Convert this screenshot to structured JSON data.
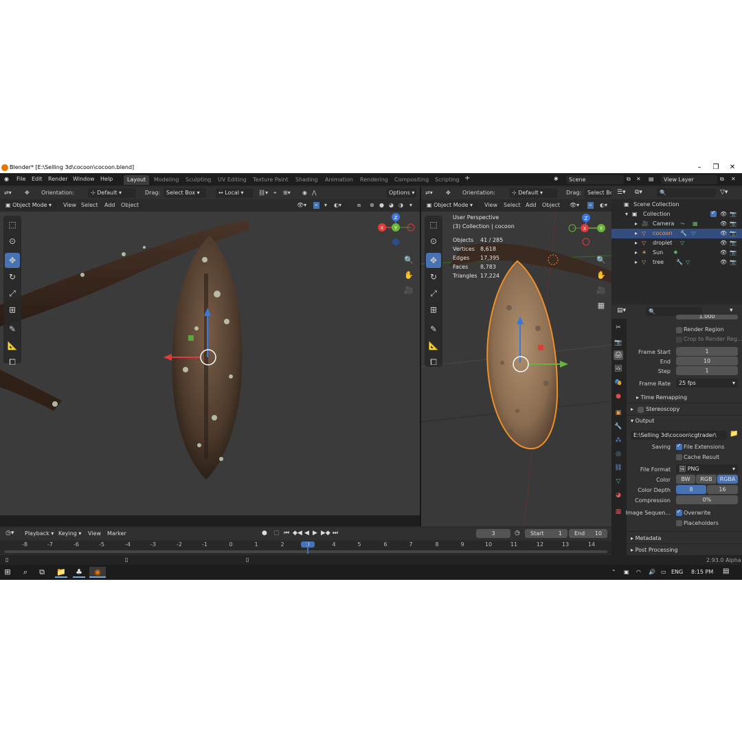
{
  "window": {
    "title": "Blender* [E:\\Selling 3d\\cocoon\\cocoon.blend]",
    "minimize_icon": "minimize-icon",
    "maximize_icon": "maximize-icon",
    "close_icon": "close-icon"
  },
  "menu": [
    "File",
    "Edit",
    "Render",
    "Window",
    "Help"
  ],
  "workspaces": [
    "Layout",
    "Modeling",
    "Sculpting",
    "UV Editing",
    "Texture Paint",
    "Shading",
    "Animation",
    "Rendering",
    "Compositing",
    "Scripting"
  ],
  "add_workspace": "+",
  "scene": {
    "name": "Scene",
    "view_layer": "View Layer"
  },
  "left_header": {
    "orientation_label": "Orientation:",
    "orientation_value": "Default",
    "drag_label": "Drag:",
    "drag_value": "Select Box",
    "pivot_value": "Local",
    "options": "Options"
  },
  "left_viewport_header": {
    "mode": "Object Mode",
    "view": "View",
    "select": "Select",
    "add": "Add",
    "object": "Object"
  },
  "right_header": {
    "orientation_label": "Orientation:",
    "orientation_value": "Default",
    "drag_label": "Drag:",
    "drag_value": "Select Bo"
  },
  "right_viewport_header": {
    "mode": "Object Mode",
    "view": "View",
    "select": "Select",
    "add": "Add",
    "object": "Object"
  },
  "overlay_text": {
    "perspective": "User Perspective",
    "collection": "(3) Collection | cocoon",
    "stats": [
      {
        "label": "Objects",
        "value": "41 / 285"
      },
      {
        "label": "Vertices",
        "value": "8,618"
      },
      {
        "label": "Edges",
        "value": "17,395"
      },
      {
        "label": "Faces",
        "value": "8,783"
      },
      {
        "label": "Triangles",
        "value": "17,224"
      }
    ]
  },
  "gizmo_axes": {
    "x": "X",
    "y": "Y",
    "z": "Z"
  },
  "outliner": {
    "root": "Scene Collection",
    "collection": "Collection",
    "items": [
      {
        "name": "Camera",
        "selected": false
      },
      {
        "name": "cocoon",
        "selected": true
      },
      {
        "name": "droplet",
        "selected": false
      },
      {
        "name": "Sun",
        "selected": false
      },
      {
        "name": "tree",
        "selected": false
      }
    ]
  },
  "properties": {
    "top_value": "1.000",
    "render_region": "Render Region",
    "crop_region": "Crop to Render Reg...",
    "frame_start_label": "Frame Start",
    "frame_start": "1",
    "end_label": "End",
    "end": "10",
    "step_label": "Step",
    "step": "1",
    "frame_rate_label": "Frame Rate",
    "frame_rate": "25 fps",
    "time_remapping": "Time Remapping",
    "stereoscopy": "Stereoscopy",
    "output": "Output",
    "output_path": "E:\\Selling 3d\\cocoon\\cgtrader\\",
    "saving_label": "Saving",
    "file_extensions": "File Extensions",
    "cache_result": "Cache Result",
    "file_format_label": "File Format",
    "file_format": "PNG",
    "color_label": "Color",
    "color_options": [
      "BW",
      "RGB",
      "RGBA"
    ],
    "color_depth_label": "Color Depth",
    "color_depth_options": [
      "8",
      "16"
    ],
    "compression_label": "Compression",
    "compression": "0%",
    "image_sequence_label": "Image Sequen...",
    "overwrite": "Overwrite",
    "placeholders": "Placeholders",
    "metadata": "Metadata",
    "post_processing": "Post Processing"
  },
  "timeline": {
    "playback": "Playback",
    "keying": "Keying",
    "view": "View",
    "marker": "Marker",
    "current_frame": "3",
    "start_label": "Start",
    "start": "1",
    "end_label": "End",
    "end": "10",
    "ruler": [
      "-8",
      "-7",
      "-6",
      "-5",
      "-4",
      "-3",
      "-2",
      "-1",
      "0",
      "1",
      "2",
      "3",
      "4",
      "5",
      "6",
      "7",
      "8",
      "9",
      "10",
      "11",
      "12",
      "13",
      "14"
    ]
  },
  "status": {
    "version": "2.93.0 Alpha"
  },
  "taskbar": {
    "language": "ENG",
    "time": "8:15 PM"
  }
}
